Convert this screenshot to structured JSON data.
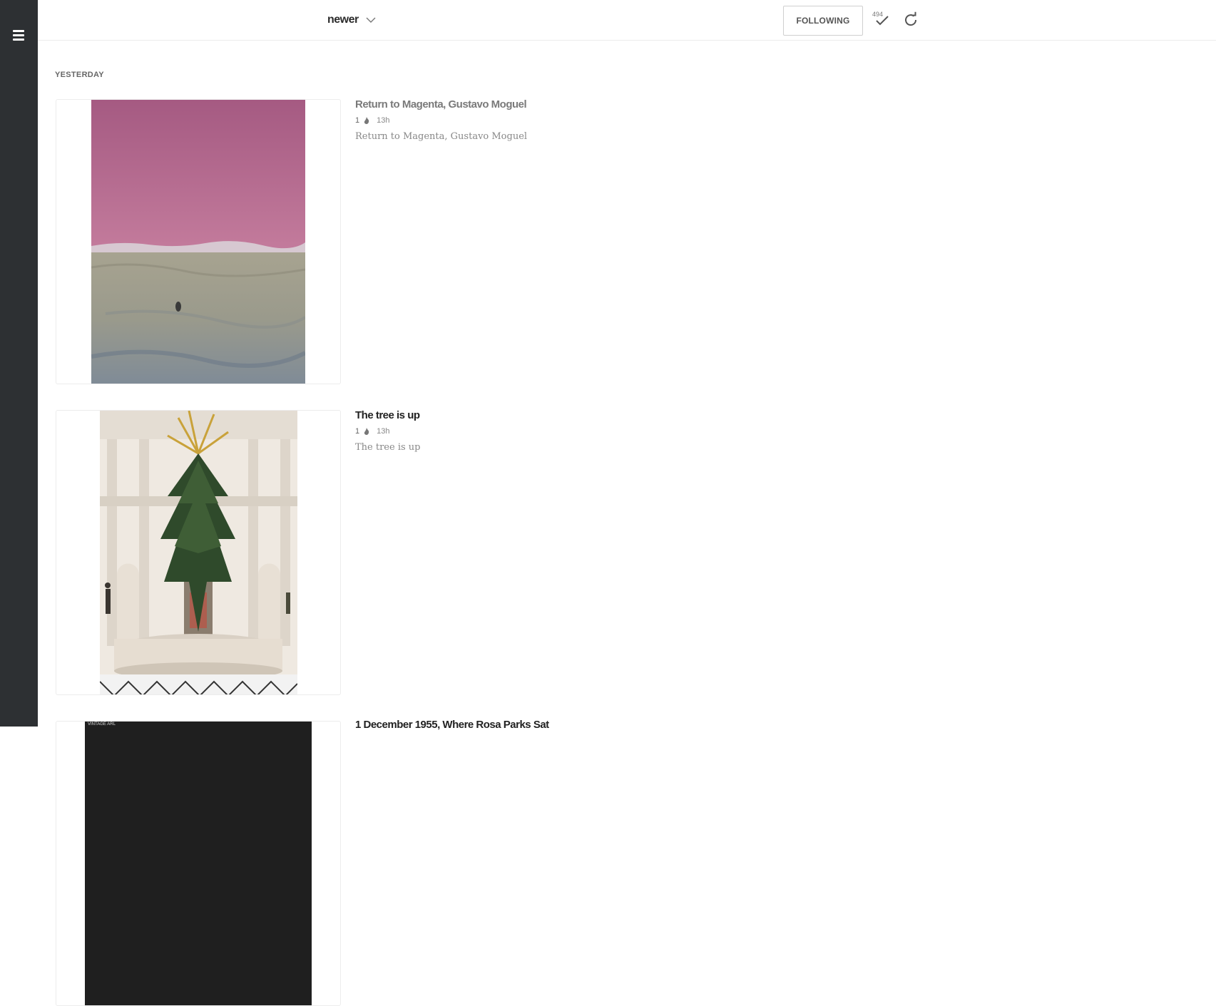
{
  "sidebar": {
    "menu_icon": "hamburger-icon"
  },
  "toolbar": {
    "sort_label": "newer",
    "following_label": "FOLLOWING",
    "unread_count": "494",
    "mark_read_icon": "checkmark-icon",
    "refresh_icon": "refresh-icon"
  },
  "feed": {
    "section_label": "YESTERDAY",
    "entries": [
      {
        "title": "Return to Magenta, Gustavo Moguel",
        "engagement": "1",
        "age": "13h",
        "summary": "Return to Magenta, Gustavo Moguel",
        "title_color": "#7a7a7a"
      },
      {
        "title": "The tree is up",
        "engagement": "1",
        "age": "13h",
        "summary": "The tree is up",
        "title_color": "#222222"
      },
      {
        "title": "1 December 1955, Where Rosa Parks Sat",
        "thumbnail_text": "VINTAGE ARL"
      }
    ]
  },
  "colors": {
    "sidebar_bg": "#2d3033",
    "accent_magenta": "#b36a8c"
  }
}
